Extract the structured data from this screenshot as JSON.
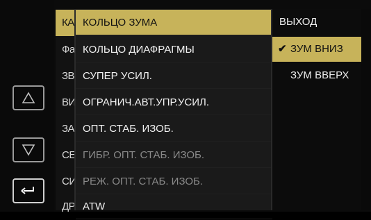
{
  "left_nav": {
    "up_icon": "triangle-up-icon",
    "down_icon": "triangle-down-icon",
    "back_icon": "return-arrow-icon"
  },
  "parent_menu": {
    "items": [
      "КА",
      "Фа",
      "ЗВ",
      "ВИ",
      "ЗА",
      "СЕ",
      "СИ",
      "ДР"
    ]
  },
  "menu": {
    "items": [
      {
        "label": "КОЛЬЦО ЗУМА",
        "state": "selected"
      },
      {
        "label": "КОЛЬЦО ДИАФРАГМЫ",
        "state": "normal"
      },
      {
        "label": "СУПЕР УСИЛ.",
        "state": "normal"
      },
      {
        "label": "ОГРАНИЧ.АВТ.УПР.УСИЛ.",
        "state": "normal"
      },
      {
        "label": "ОПТ. СТАБ. ИЗОБ.",
        "state": "normal"
      },
      {
        "label": "ГИБР. ОПТ. СТАБ. ИЗОБ.",
        "state": "dim"
      },
      {
        "label": "РЕЖ. ОПТ. СТАБ. ИЗОБ.",
        "state": "dim"
      },
      {
        "label": "ATW",
        "state": "normal"
      }
    ]
  },
  "submenu": {
    "exit_label": "ВЫХОД",
    "options": [
      {
        "label": "ЗУМ ВНИЗ",
        "checked": true
      },
      {
        "label": "ЗУМ ВВЕРХ",
        "checked": false
      }
    ],
    "check_glyph": "✔"
  },
  "colors": {
    "highlight": "#c7b35a",
    "text": "#f2f2f2",
    "dim_text": "#8a8a8a"
  }
}
